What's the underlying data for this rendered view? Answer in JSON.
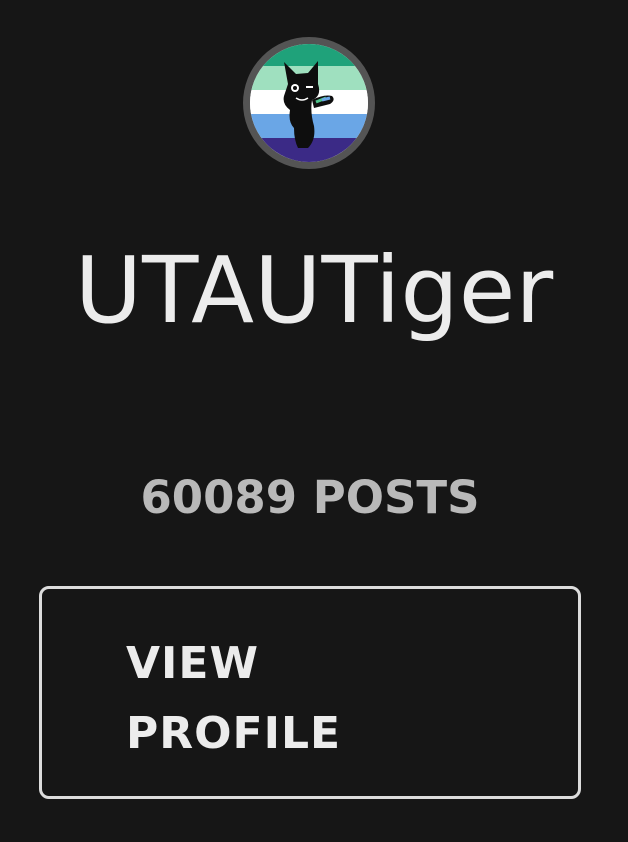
{
  "profile": {
    "avatar_icon": "black-cat-avatar-icon",
    "avatar_flag_colors": [
      "#1fa27a",
      "#9fe0bf",
      "#ffffff",
      "#6aa6e6",
      "#3b2a86"
    ],
    "username": "UTAUTiger",
    "post_count": "60089 POSTS",
    "view_profile_label": "VIEW PROFILE"
  }
}
